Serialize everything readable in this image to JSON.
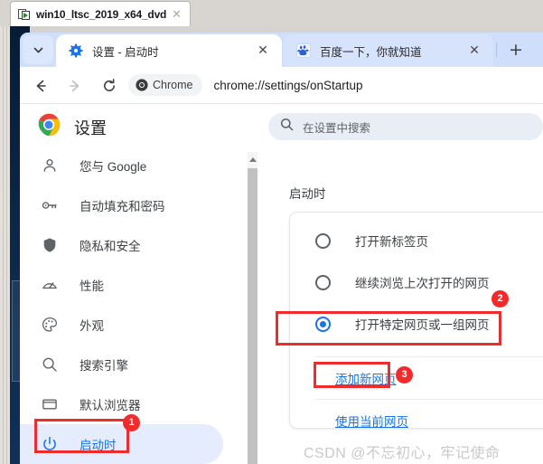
{
  "vmware": {
    "tab_title": "win10_ltsc_2019_x64_dvd",
    "tab_close_label": "✕",
    "tab_icon": "vm-thumbnail-icon"
  },
  "browser": {
    "tab_list_chevron_icon": "chevron-down-icon",
    "tabs": [
      {
        "title": "设置 - 启动时",
        "favicon": "gear-icon",
        "active": true,
        "close_label": "✕"
      },
      {
        "title": "百度一下，你就知道",
        "favicon": "baidu-paw-icon",
        "active": false,
        "close_label": "✕"
      }
    ],
    "new_tab_label": "+",
    "nav": {
      "back_icon": "arrow-left-icon",
      "forward_icon": "arrow-right-icon",
      "reload_icon": "reload-icon"
    },
    "omnibox": {
      "chip_label": "Chrome",
      "chip_icon": "chrome-logo-icon",
      "url": "chrome://settings/onStartup"
    }
  },
  "settings": {
    "logo_icon": "chrome-logo-icon",
    "title": "设置",
    "search": {
      "icon": "search-icon",
      "placeholder": "在设置中搜索",
      "value": ""
    },
    "sidebar": [
      {
        "label": "您与 Google",
        "icon": "person-icon",
        "selected": false
      },
      {
        "label": "自动填充和密码",
        "icon": "key-icon",
        "selected": false
      },
      {
        "label": "隐私和安全",
        "icon": "shield-icon",
        "selected": false
      },
      {
        "label": "性能",
        "icon": "speedometer-icon",
        "selected": false
      },
      {
        "label": "外观",
        "icon": "palette-icon",
        "selected": false
      },
      {
        "label": "搜索引擎",
        "icon": "search-icon",
        "selected": false
      },
      {
        "label": "默认浏览器",
        "icon": "window-icon",
        "selected": false
      },
      {
        "label": "启动时",
        "icon": "power-icon",
        "selected": true
      }
    ],
    "main": {
      "section_title": "启动时",
      "options": [
        {
          "label": "打开新标签页",
          "selected": false
        },
        {
          "label": "继续浏览上次打开的网页",
          "selected": false
        },
        {
          "label": "打开特定网页或一组网页",
          "selected": true
        }
      ],
      "links": [
        {
          "label": "添加新网页"
        },
        {
          "label": "使用当前网页"
        }
      ]
    }
  },
  "annotations": {
    "accent_color": "#f32a2a",
    "badges": [
      {
        "number": "1",
        "target": "sidebar-item-startup"
      },
      {
        "number": "2",
        "target": "radio-open-specific-pages"
      },
      {
        "number": "3",
        "target": "add-new-page-link"
      }
    ]
  },
  "watermark": {
    "text": "CSDN @不忘初心，牢记使命"
  }
}
